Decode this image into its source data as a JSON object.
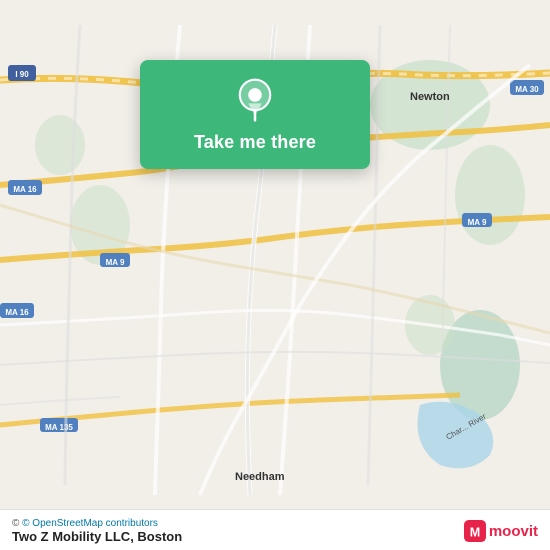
{
  "map": {
    "background_color": "#f2efe9",
    "alt": "Map of Boston area showing Newton, Needham, MA 9, MA 16, MA 135, I 90, MA 30 roads"
  },
  "location_card": {
    "button_label": "Take me there",
    "pin_icon": "location-pin-icon"
  },
  "bottom_bar": {
    "osm_credit": "© OpenStreetMap contributors",
    "company_name": "Two Z Mobility LLC",
    "city": "Boston",
    "moovit_label": "moovit"
  },
  "road_labels": [
    "I 90",
    "MA 16",
    "MA 9",
    "MA 30",
    "MA 135",
    "Newton",
    "Needham",
    "Charles River"
  ]
}
